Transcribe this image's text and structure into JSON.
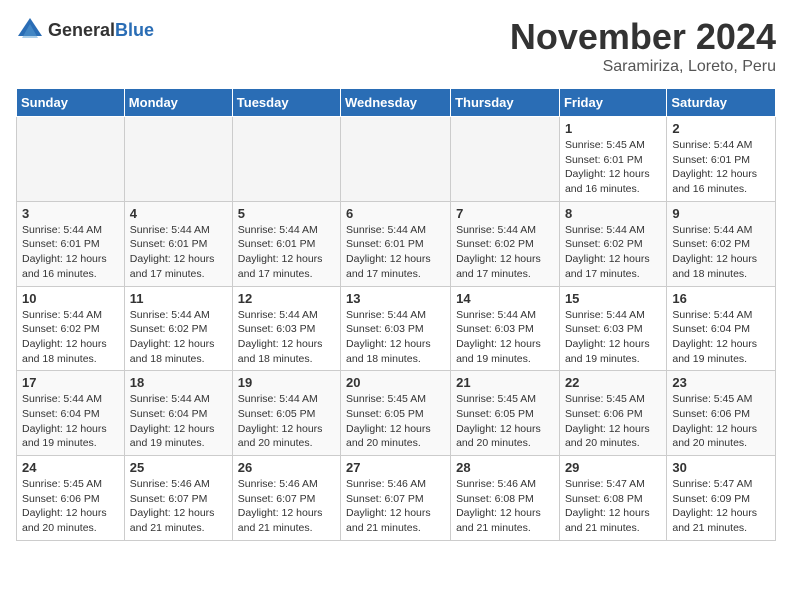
{
  "header": {
    "logo_general": "General",
    "logo_blue": "Blue",
    "month_title": "November 2024",
    "location": "Saramiriza, Loreto, Peru"
  },
  "days_of_week": [
    "Sunday",
    "Monday",
    "Tuesday",
    "Wednesday",
    "Thursday",
    "Friday",
    "Saturday"
  ],
  "weeks": [
    [
      {
        "day": "",
        "info": ""
      },
      {
        "day": "",
        "info": ""
      },
      {
        "day": "",
        "info": ""
      },
      {
        "day": "",
        "info": ""
      },
      {
        "day": "",
        "info": ""
      },
      {
        "day": "1",
        "info": "Sunrise: 5:45 AM\nSunset: 6:01 PM\nDaylight: 12 hours and 16 minutes."
      },
      {
        "day": "2",
        "info": "Sunrise: 5:44 AM\nSunset: 6:01 PM\nDaylight: 12 hours and 16 minutes."
      }
    ],
    [
      {
        "day": "3",
        "info": "Sunrise: 5:44 AM\nSunset: 6:01 PM\nDaylight: 12 hours and 16 minutes."
      },
      {
        "day": "4",
        "info": "Sunrise: 5:44 AM\nSunset: 6:01 PM\nDaylight: 12 hours and 17 minutes."
      },
      {
        "day": "5",
        "info": "Sunrise: 5:44 AM\nSunset: 6:01 PM\nDaylight: 12 hours and 17 minutes."
      },
      {
        "day": "6",
        "info": "Sunrise: 5:44 AM\nSunset: 6:01 PM\nDaylight: 12 hours and 17 minutes."
      },
      {
        "day": "7",
        "info": "Sunrise: 5:44 AM\nSunset: 6:02 PM\nDaylight: 12 hours and 17 minutes."
      },
      {
        "day": "8",
        "info": "Sunrise: 5:44 AM\nSunset: 6:02 PM\nDaylight: 12 hours and 17 minutes."
      },
      {
        "day": "9",
        "info": "Sunrise: 5:44 AM\nSunset: 6:02 PM\nDaylight: 12 hours and 18 minutes."
      }
    ],
    [
      {
        "day": "10",
        "info": "Sunrise: 5:44 AM\nSunset: 6:02 PM\nDaylight: 12 hours and 18 minutes."
      },
      {
        "day": "11",
        "info": "Sunrise: 5:44 AM\nSunset: 6:02 PM\nDaylight: 12 hours and 18 minutes."
      },
      {
        "day": "12",
        "info": "Sunrise: 5:44 AM\nSunset: 6:03 PM\nDaylight: 12 hours and 18 minutes."
      },
      {
        "day": "13",
        "info": "Sunrise: 5:44 AM\nSunset: 6:03 PM\nDaylight: 12 hours and 18 minutes."
      },
      {
        "day": "14",
        "info": "Sunrise: 5:44 AM\nSunset: 6:03 PM\nDaylight: 12 hours and 19 minutes."
      },
      {
        "day": "15",
        "info": "Sunrise: 5:44 AM\nSunset: 6:03 PM\nDaylight: 12 hours and 19 minutes."
      },
      {
        "day": "16",
        "info": "Sunrise: 5:44 AM\nSunset: 6:04 PM\nDaylight: 12 hours and 19 minutes."
      }
    ],
    [
      {
        "day": "17",
        "info": "Sunrise: 5:44 AM\nSunset: 6:04 PM\nDaylight: 12 hours and 19 minutes."
      },
      {
        "day": "18",
        "info": "Sunrise: 5:44 AM\nSunset: 6:04 PM\nDaylight: 12 hours and 19 minutes."
      },
      {
        "day": "19",
        "info": "Sunrise: 5:44 AM\nSunset: 6:05 PM\nDaylight: 12 hours and 20 minutes."
      },
      {
        "day": "20",
        "info": "Sunrise: 5:45 AM\nSunset: 6:05 PM\nDaylight: 12 hours and 20 minutes."
      },
      {
        "day": "21",
        "info": "Sunrise: 5:45 AM\nSunset: 6:05 PM\nDaylight: 12 hours and 20 minutes."
      },
      {
        "day": "22",
        "info": "Sunrise: 5:45 AM\nSunset: 6:06 PM\nDaylight: 12 hours and 20 minutes."
      },
      {
        "day": "23",
        "info": "Sunrise: 5:45 AM\nSunset: 6:06 PM\nDaylight: 12 hours and 20 minutes."
      }
    ],
    [
      {
        "day": "24",
        "info": "Sunrise: 5:45 AM\nSunset: 6:06 PM\nDaylight: 12 hours and 20 minutes."
      },
      {
        "day": "25",
        "info": "Sunrise: 5:46 AM\nSunset: 6:07 PM\nDaylight: 12 hours and 21 minutes."
      },
      {
        "day": "26",
        "info": "Sunrise: 5:46 AM\nSunset: 6:07 PM\nDaylight: 12 hours and 21 minutes."
      },
      {
        "day": "27",
        "info": "Sunrise: 5:46 AM\nSunset: 6:07 PM\nDaylight: 12 hours and 21 minutes."
      },
      {
        "day": "28",
        "info": "Sunrise: 5:46 AM\nSunset: 6:08 PM\nDaylight: 12 hours and 21 minutes."
      },
      {
        "day": "29",
        "info": "Sunrise: 5:47 AM\nSunset: 6:08 PM\nDaylight: 12 hours and 21 minutes."
      },
      {
        "day": "30",
        "info": "Sunrise: 5:47 AM\nSunset: 6:09 PM\nDaylight: 12 hours and 21 minutes."
      }
    ]
  ]
}
